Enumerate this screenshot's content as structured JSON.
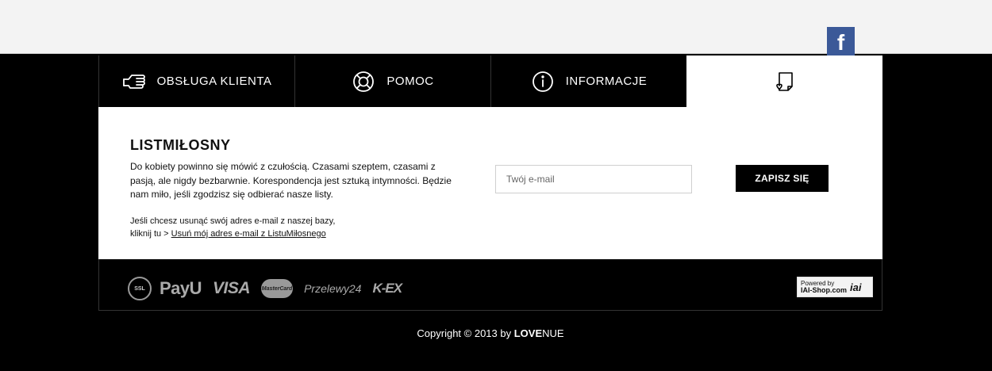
{
  "social": {
    "facebook_letter": "f"
  },
  "tabs": [
    {
      "label": "OBSŁUGA KLIENTA",
      "icon": "customer-service-hand-icon"
    },
    {
      "label": "POMOC",
      "icon": "lifebuoy-icon"
    },
    {
      "label": "INFORMACJE",
      "icon": "info-icon"
    },
    {
      "label": "",
      "icon": "letter-heart-icon"
    }
  ],
  "newsletter": {
    "title": "LISTMIŁOSNY",
    "description": "Do kobiety powinno się mówić z czułością. Czasami szeptem, czasami z pasją, ale nigdy bezbarwnie. Korespondencja jest sztuką intymności. Będzie nam miło, jeśli zgodzisz się odbierać nasze listy.",
    "remove_text_1": "Jeśli chcesz usunąć swój adres e-mail z naszej bazy,",
    "remove_text_2": "kliknij tu >",
    "remove_link": "Usuń mój adres e-mail z ListuMiłosnego",
    "email_placeholder": "Twój e-mail",
    "email_value": "",
    "subscribe_label": "ZAPISZ SIĘ"
  },
  "payments": {
    "ssl": "SSL",
    "payu": "PayU",
    "visa": "VISA",
    "mastercard": "MasterCard",
    "przelewy": "Przelewy24",
    "kex": "K-EX",
    "powered_by": "Powered by",
    "iai_shop": "IAI-Shop.com",
    "iai": "iai"
  },
  "footer": {
    "copyright_prefix": "Copyright © 2013 by ",
    "brand_bold": "LOVE",
    "brand_rest": "NUE"
  },
  "colors": {
    "facebook": "#3b5998",
    "background": "#000000",
    "panel": "#ffffff"
  }
}
